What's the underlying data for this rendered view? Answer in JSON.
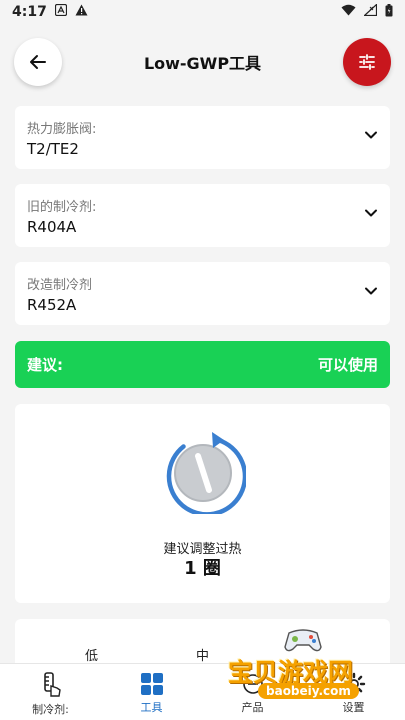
{
  "status_bar": {
    "time": "4:17"
  },
  "header": {
    "title": "Low-GWP工具"
  },
  "selects": [
    {
      "label": "热力膨胀阀:",
      "value": "T2/TE2"
    },
    {
      "label": "旧的制冷剂:",
      "value": "R404A"
    },
    {
      "label": "改造制冷剂",
      "value": "R452A"
    }
  ],
  "advice": {
    "label": "建议:",
    "value": "可以使用"
  },
  "recommendation": {
    "text": "建议调整过热",
    "turns": "1 圈"
  },
  "levels": [
    "低",
    "中"
  ],
  "bottom_nav": [
    {
      "label": "制冷剂:",
      "icon": "thermometer-hand-icon"
    },
    {
      "label": "工具",
      "icon": "grid-icon"
    },
    {
      "label": "产品",
      "icon": "products-icon"
    },
    {
      "label": "设置",
      "icon": "gear-icon"
    }
  ],
  "watermark": {
    "text": "宝贝游戏网",
    "url": "baobeiy.com"
  },
  "colors": {
    "accent_red": "#c8161d",
    "advice_green": "#19d155",
    "active_blue": "#1f6fc4"
  }
}
